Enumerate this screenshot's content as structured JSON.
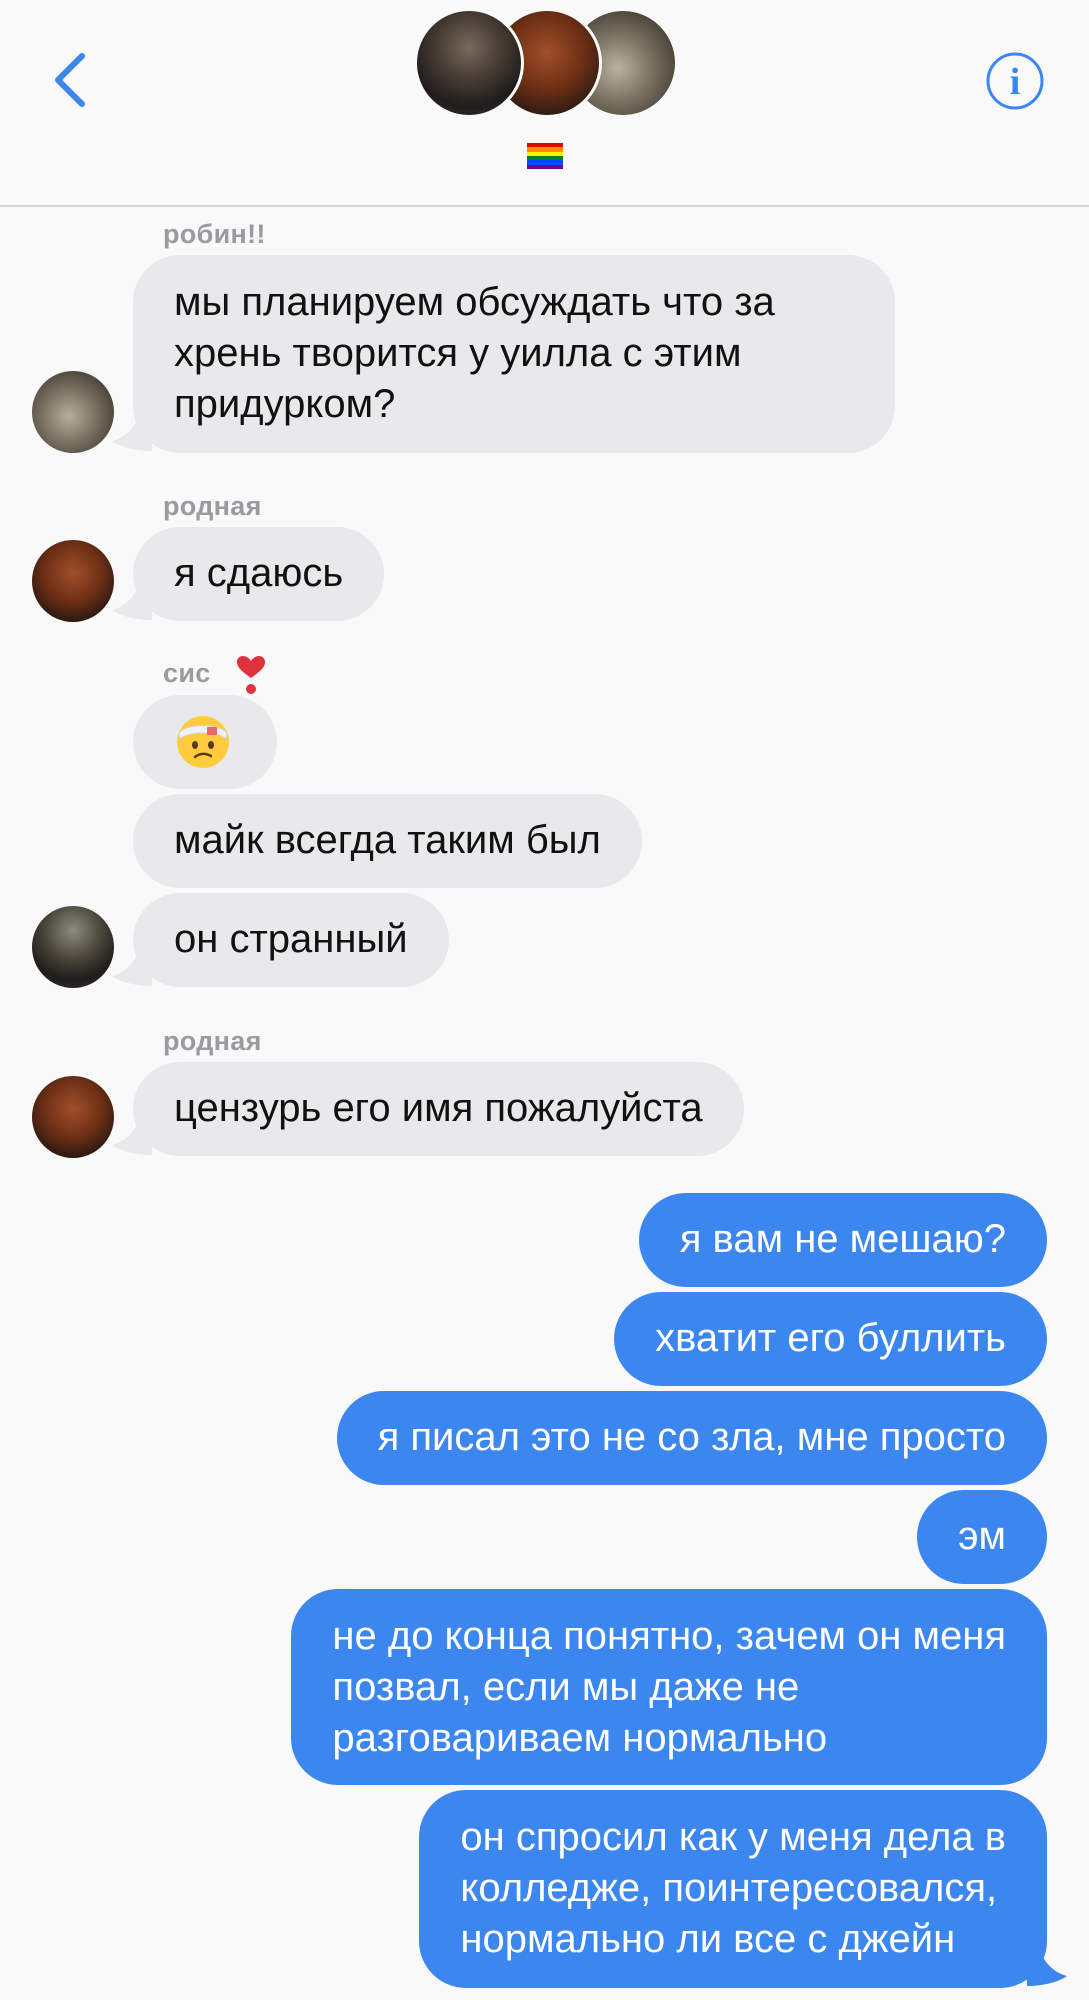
{
  "header": {
    "back_icon": "chevron-left-icon",
    "info_icon": "info-circle-icon",
    "group_icon": "rainbow-flag-icon",
    "accent_color": "#3b86ef"
  },
  "messages": [
    {
      "sender": "робин!!",
      "text": "мы планируем обсуждать что за\nхрень творится у уилла с этим\nпридурком?"
    },
    {
      "sender": "родная",
      "text": "я сдаюсь"
    },
    {
      "sender": "сис",
      "sender_emoji": "heart-exclamation-icon",
      "emoji": "face-with-head-bandage-icon",
      "text": "майк всегда таким был"
    },
    {
      "text": "он странный"
    },
    {
      "sender": "родная",
      "text": "цензурь его имя пожалуйста"
    }
  ],
  "outgoing": [
    "я вам не мешаю?",
    "хватит его буллить",
    "я писал это не со зла, мне просто",
    "эм",
    "не до конца понятно, зачем он меня\nпозвал, если мы даже не\nразговариваем нормально",
    "он спросил как у меня дела в\nколледже, поинтересовался,\nнормально ли все с джейн"
  ]
}
